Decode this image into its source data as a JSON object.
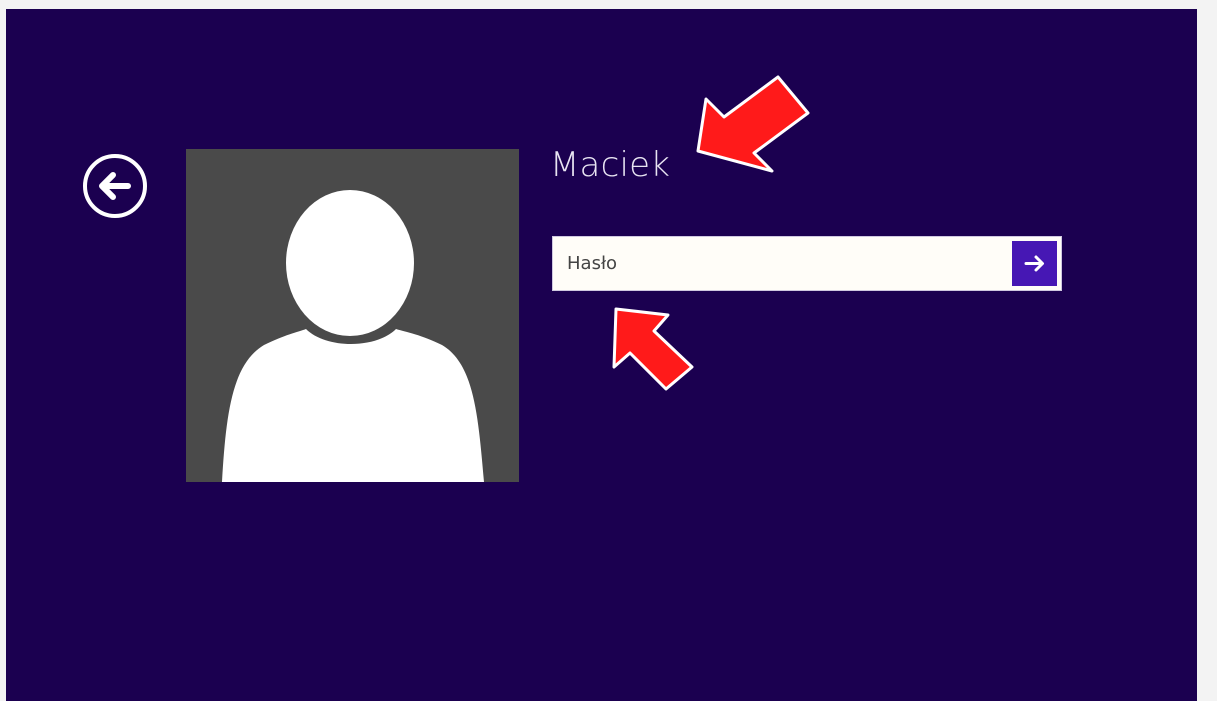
{
  "login": {
    "username": "Maciek",
    "password_placeholder": "Hasło",
    "password_value": ""
  },
  "icons": {
    "back": "back-arrow-circle-icon",
    "submit": "arrow-right-icon",
    "avatar": "user-silhouette-icon"
  },
  "colors": {
    "background": "#1b0050",
    "avatar_bg": "#4a4a4a",
    "submit_button": "#4617b4",
    "annotation": "#ff1a1a"
  }
}
